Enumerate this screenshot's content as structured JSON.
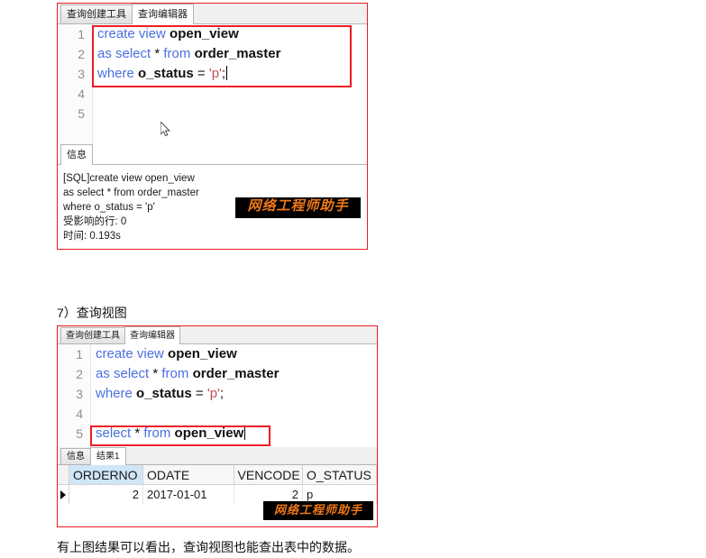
{
  "document": {
    "section_heading": "7）查询视图",
    "caption": "有上图结果可以看出，查询视图也能查出表中的数据。"
  },
  "watermark": {
    "text": "网络工程师助手",
    "bg": "#000000",
    "fg": "#f07818"
  },
  "colors": {
    "highlight_red": "#ee1c24",
    "keyword_blue": "#4a6fe0",
    "string_red": "#c0504d",
    "selected_header_blue": "#cfe6f7"
  },
  "panel1": {
    "tabs": [
      {
        "label": "查询创建工具",
        "active": false
      },
      {
        "label": "查询编辑器",
        "active": true
      }
    ],
    "editor": {
      "lines": [
        {
          "num": "1",
          "tokens": [
            {
              "t": "create view ",
              "c": "kw"
            },
            {
              "t": "open_view",
              "c": "id"
            }
          ]
        },
        {
          "num": "2",
          "tokens": [
            {
              "t": "as select ",
              "c": "kw"
            },
            {
              "t": "* ",
              "c": "op"
            },
            {
              "t": "from ",
              "c": "kw"
            },
            {
              "t": "order_master",
              "c": "id"
            }
          ]
        },
        {
          "num": "3",
          "tokens": [
            {
              "t": "where ",
              "c": "kw"
            },
            {
              "t": "o_status ",
              "c": "id"
            },
            {
              "t": "= ",
              "c": "op"
            },
            {
              "t": "'p'",
              "c": "str"
            },
            {
              "t": ";",
              "c": "op"
            }
          ],
          "caret": true
        },
        {
          "num": "4",
          "tokens": []
        },
        {
          "num": "5",
          "tokens": []
        }
      ]
    },
    "output_tabs": [
      {
        "label": "信息",
        "active": true
      }
    ],
    "messages": [
      "[SQL]create view open_view",
      "as select * from order_master",
      "where o_status = 'p'",
      "受影响的行: 0",
      "时间: 0.193s"
    ]
  },
  "panel2": {
    "tabs": [
      {
        "label": "查询创建工具",
        "active": false
      },
      {
        "label": "查询编辑器",
        "active": true
      }
    ],
    "editor": {
      "lines": [
        {
          "num": "1",
          "tokens": [
            {
              "t": "create view ",
              "c": "kw"
            },
            {
              "t": "open_view",
              "c": "id"
            }
          ]
        },
        {
          "num": "2",
          "tokens": [
            {
              "t": "as select ",
              "c": "kw"
            },
            {
              "t": "* ",
              "c": "op"
            },
            {
              "t": "from ",
              "c": "kw"
            },
            {
              "t": "order_master",
              "c": "id"
            }
          ]
        },
        {
          "num": "3",
          "tokens": [
            {
              "t": "where ",
              "c": "kw"
            },
            {
              "t": "o_status ",
              "c": "id"
            },
            {
              "t": "= ",
              "c": "op"
            },
            {
              "t": "'p'",
              "c": "str"
            },
            {
              "t": ";",
              "c": "op"
            }
          ]
        },
        {
          "num": "4",
          "tokens": []
        },
        {
          "num": "5",
          "tokens": [
            {
              "t": "select ",
              "c": "kw"
            },
            {
              "t": "* ",
              "c": "op"
            },
            {
              "t": "from ",
              "c": "kw"
            },
            {
              "t": "open_view",
              "c": "id"
            }
          ],
          "caret": true
        }
      ]
    },
    "output_tabs": [
      {
        "label": "信息",
        "active": false
      },
      {
        "label": "结果1",
        "active": true
      }
    ],
    "result_grid": {
      "columns": [
        {
          "label": "ORDERNO",
          "selected": true,
          "width": 88,
          "align": "num"
        },
        {
          "label": "ODATE",
          "selected": false,
          "width": 108,
          "align": "text"
        },
        {
          "label": "VENCODE",
          "selected": false,
          "width": 82,
          "align": "num"
        },
        {
          "label": "O_STATUS",
          "selected": false,
          "width": 88,
          "align": "text"
        }
      ],
      "rows": [
        {
          "current": true,
          "cells": [
            "2",
            "2017-01-01",
            "2",
            "p"
          ]
        }
      ]
    }
  }
}
